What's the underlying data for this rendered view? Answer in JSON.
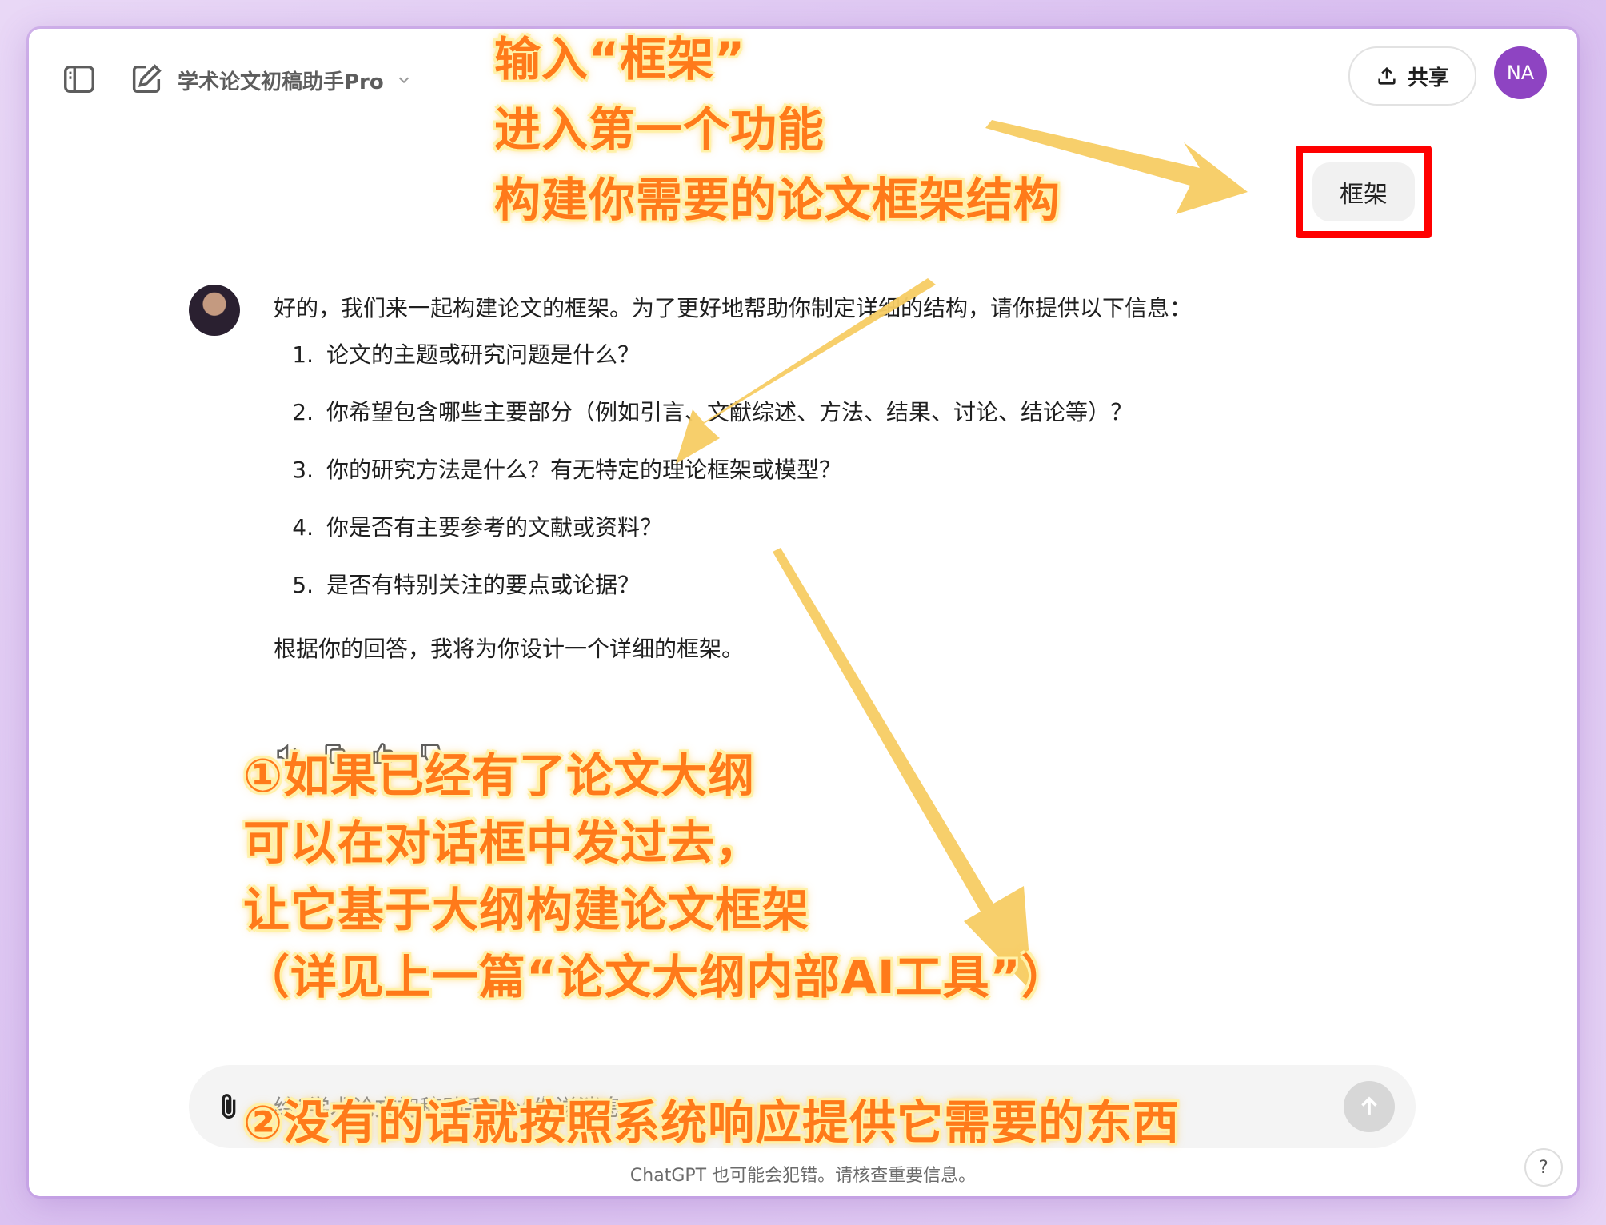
{
  "header": {
    "gpt_name": "学术论文初稿助手Pro",
    "share_label": "共享",
    "user_initials": "NA"
  },
  "user_message": {
    "text": "框架"
  },
  "assistant_message": {
    "intro": "好的，我们来一起构建论文的框架。为了更好地帮助你制定详细的结构，请你提供以下信息：",
    "items": [
      {
        "num": "1.",
        "text": "论文的主题或研究问题是什么？"
      },
      {
        "num": "2.",
        "text": "你希望包含哪些主要部分（例如引言、文献综述、方法、结果、讨论、结论等）？"
      },
      {
        "num": "3.",
        "text": "你的研究方法是什么？有无特定的理论框架或模型？"
      },
      {
        "num": "4.",
        "text": "你是否有主要参考的文献或资料？"
      },
      {
        "num": "5.",
        "text": "是否有特别关注的要点或论据？"
      }
    ],
    "outro": "根据你的回答，我将为你设计一个详细的框架。"
  },
  "composer": {
    "placeholder": "给“学术论文初稿助手Pro”发送消息"
  },
  "disclaimer": "ChatGPT 也可能会犯错。请核查重要信息。",
  "help_label": "?",
  "annotations": {
    "top": [
      "输入“框架”",
      "进入第一个功能",
      "构建你需要的论文框架结构"
    ],
    "middle": [
      "①如果已经有了论文大纲",
      "可以在对话框中发过去，",
      "让它基于大纲构建论文框架",
      "（详见上一篇“论文大纲内部AI工具”）"
    ],
    "bottom": "②没有的话就按照系统响应提供它需要的东西"
  },
  "colors": {
    "annotation_text": "#ff7a1a",
    "highlight_box": "#ff0000",
    "arrow_fill": "#f7cc63",
    "avatar_bg": "#8e44c2"
  }
}
